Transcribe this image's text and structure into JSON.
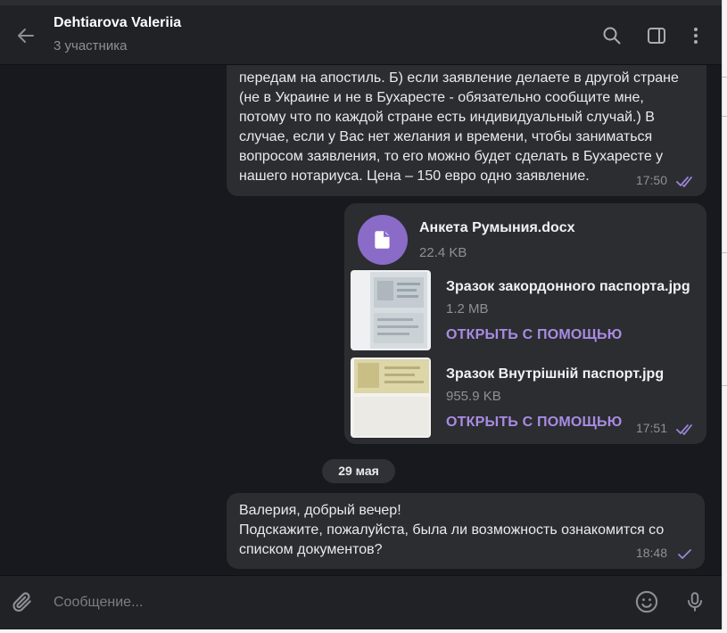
{
  "header": {
    "title": "Dehtiarova Valeriia",
    "subtitle": "3 участника"
  },
  "messages": [
    {
      "text": "передам на апостиль. Б) если заявление делаете в другой стране\n(не в Украине и не в Бухаресте - обязательно сообщите мне,\nпотому что по каждой стране есть индивидуальный случай.) В\nслучае, если у Вас нет желания и времени, чтобы заниматься\nвопросом заявления, то его можно будет сделать в Бухаресте у\nнашего нотариуса. Цена – 150 евро одно заявление.",
      "time": "17:50",
      "status": "read"
    },
    {
      "files": [
        {
          "name": "Анкета Румыния.docx",
          "size": "22.4 KB",
          "icon": "document-icon"
        },
        {
          "name": "Зразок закордонного паспорта.jpg",
          "size": "1.2 MB",
          "action": "ОТКРЫТЬ С ПОМОЩЬЮ"
        },
        {
          "name": "Зразок Внутрішній паспорт.jpg",
          "size": "955.9 KB",
          "action": "ОТКРЫТЬ С ПОМОЩЬЮ"
        }
      ],
      "time": "17:51",
      "status": "read"
    },
    {
      "text": "Валерия, добрый вечер!\nПодскажите, пожалуйста, была ли возможность ознакомится со\nсписком документов?",
      "time": "18:48",
      "status": "sent"
    }
  ],
  "date_separator": "29 мая",
  "composer": {
    "placeholder": "Сообщение..."
  },
  "colors": {
    "background": "#18191e",
    "bubble": "#2b2d31",
    "accent": "#8b6bc8",
    "link": "#a98be2"
  }
}
